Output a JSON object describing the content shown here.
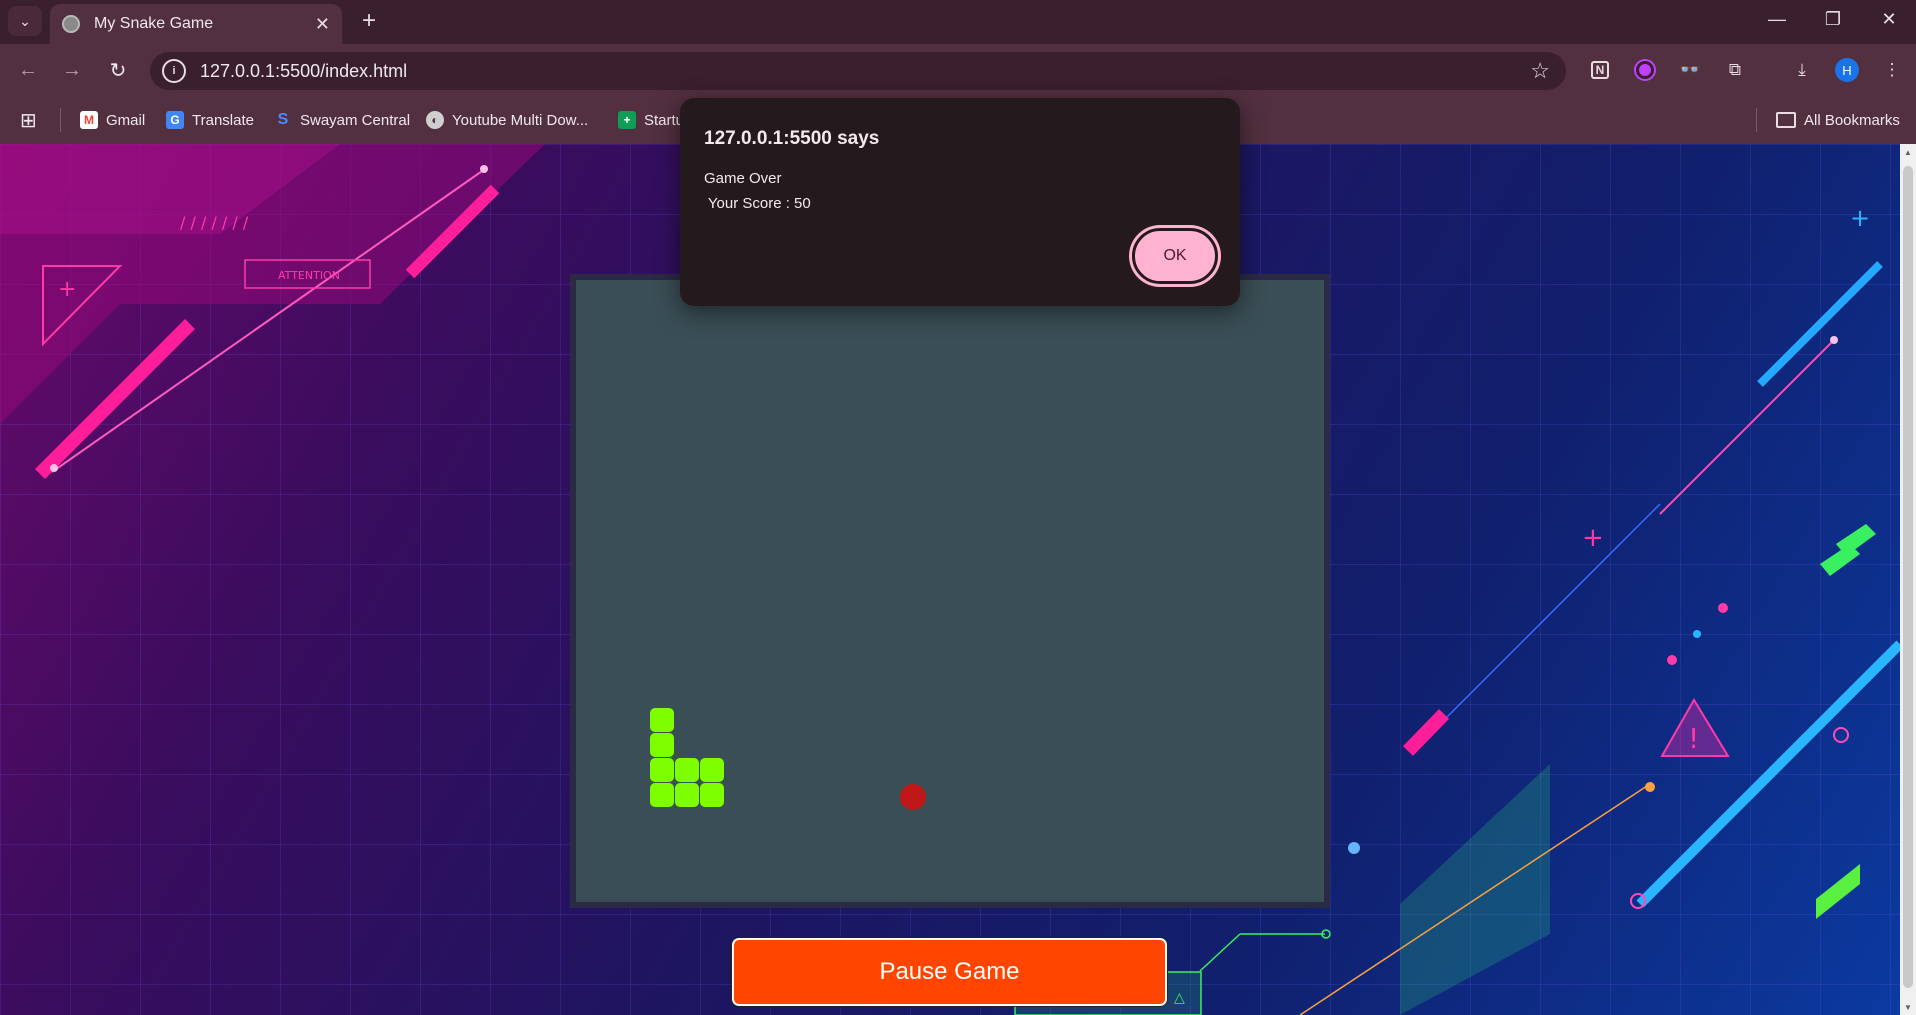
{
  "browser": {
    "tab_title": "My Snake Game",
    "url": "127.0.0.1:5500/index.html",
    "bookmarks": [
      {
        "label": "Gmail",
        "icon": "gmail-icon"
      },
      {
        "label": "Translate",
        "icon": "translate-icon"
      },
      {
        "label": "Swayam Central",
        "icon": "swayam-icon"
      },
      {
        "label": "Youtube Multi Dow...",
        "icon": "globe-icon"
      },
      {
        "label": "Startu",
        "icon": "sheets-icon"
      }
    ],
    "all_bookmarks": "All Bookmarks",
    "profile_initial": "H"
  },
  "game": {
    "snake": {
      "segments": [
        [
          0,
          0
        ],
        [
          0,
          1
        ],
        [
          0,
          2
        ],
        [
          1,
          2
        ],
        [
          2,
          2
        ],
        [
          0,
          3
        ],
        [
          1,
          3
        ],
        [
          2,
          3
        ]
      ],
      "color": "#7dff00"
    },
    "food": {
      "color": "#c01818"
    },
    "board_color": "#3a4e55",
    "pause_label": "Pause Game"
  },
  "dialog": {
    "title": "127.0.0.1:5500 says",
    "message": "Game Over\n Your Score : 50",
    "ok_label": "OK"
  },
  "background_labels": {
    "attention": "ATTENTION"
  }
}
